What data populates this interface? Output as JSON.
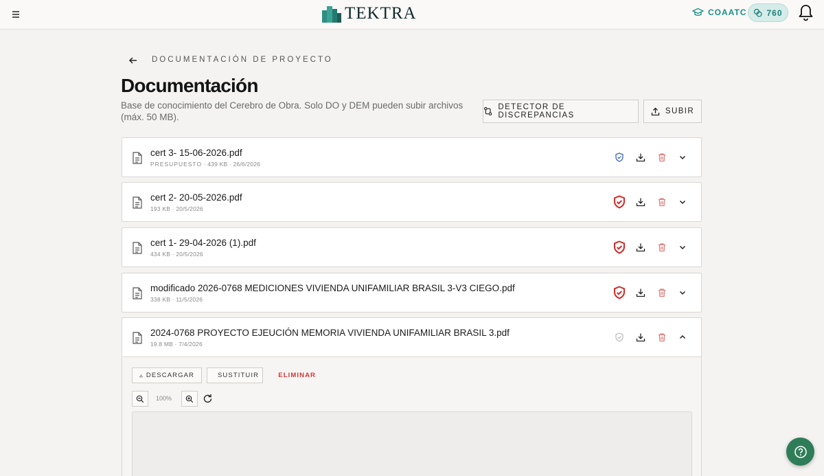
{
  "header": {
    "logo_text": "TEKTRA",
    "org_label": "COAATC",
    "credits": "760"
  },
  "breadcrumb": "DOCUMENTACIÓN DE PROYECTO",
  "page": {
    "title": "Documentación",
    "subtitle": "Base de conocimiento del Cerebro de Obra. Solo DO y DEM pueden subir archivos (máx. 50 MB)."
  },
  "actions": {
    "detector_label": "DETECTOR DE DISCREPANCIAS",
    "upload_label": "SUBIR"
  },
  "documents": [
    {
      "name": "cert 3- 15-06-2026.pdf",
      "tag": "PRESUPUESTO",
      "meta": "439 KB · 26/6/2026",
      "status": "verified-blue"
    },
    {
      "name": "cert 2- 20-05-2026.pdf",
      "tag": "",
      "meta": "193 KB · 20/5/2026",
      "status": "alert-red"
    },
    {
      "name": "cert 1- 29-04-2026 (1).pdf",
      "tag": "",
      "meta": "434 KB · 20/5/2026",
      "status": "alert-red"
    },
    {
      "name": "modificado 2026-0768 MEDICIONES VIVIENDA UNIFAMILIAR BRASIL 3-V3 CIEGO.pdf",
      "tag": "",
      "meta": "338 KB · 11/5/2026",
      "status": "alert-red"
    },
    {
      "name": "2024-0768 PROYECTO EJEUCIÓN MEMORIA VIVIENDA UNIFAMILIAR BRASIL 3.pdf",
      "tag": "",
      "meta": "19.8 MB · 7/4/2026",
      "status": "unverified-grey"
    }
  ],
  "expanded": {
    "download_label": "DESCARGAR",
    "replace_label": "SUSTITUIR",
    "delete_label": "ELIMINAR",
    "zoom": "100%"
  },
  "colors": {
    "accent": "#1a8f8a",
    "danger": "#d23434",
    "help": "#2f7d58",
    "verified": "#3a66b5"
  }
}
